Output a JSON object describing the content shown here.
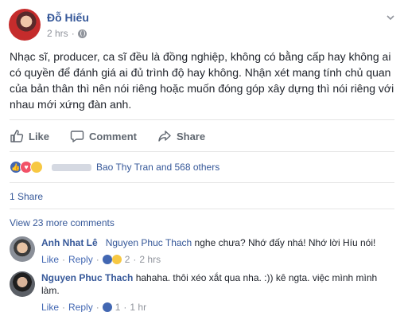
{
  "post": {
    "author": "Đỗ Hiếu",
    "time": "2 hrs",
    "dot": "·",
    "text": "Nhạc sĩ, producer, ca sĩ đều là đồng nghiệp, không có bằng cấp hay không ai có quyền để đánh giá ai đủ trình độ hay không. Nhận xét mang tính chủ quan của bản thân thì nên nói riêng hoặc muốn đóng góp xây dựng thì nói riêng với nhau mới xứng đàn anh."
  },
  "actions": {
    "like": "Like",
    "comment": "Comment",
    "share": "Share"
  },
  "reactions": {
    "summary": "Bao Thy Tran and 568 others"
  },
  "shares": "1 Share",
  "more_comments": "View 23 more comments",
  "comments": [
    {
      "author": "Anh Nhat Lê",
      "tag": "Nguyen Phuc Thach",
      "text": " nghe chưa? Nhớ đấy nhá! Nhớ lời Híu nói!",
      "like": "Like",
      "reply": "Reply",
      "count": "2",
      "time": "2 hrs"
    },
    {
      "author": "Nguyen Phuc Thach",
      "text": " hahaha. thôi xéo xắt qua nha. :)) kê ngta. việc mình mình làm.",
      "like": "Like",
      "reply": "Reply",
      "count": "1",
      "time": "1 hr"
    }
  ],
  "colors": {
    "link": "#365899",
    "muted": "#90949c",
    "like_blue": "#4267b2",
    "love_red": "#f25268",
    "haha_yellow": "#f7c843"
  }
}
